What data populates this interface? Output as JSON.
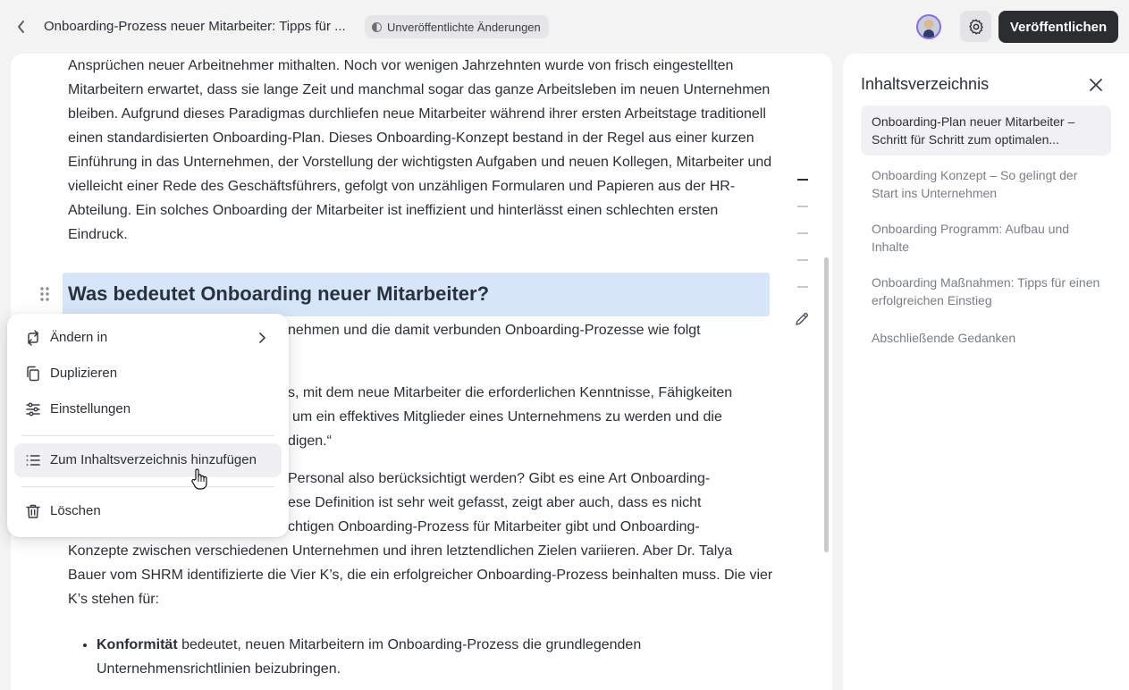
{
  "header": {
    "title": "Onboarding-Prozess neuer Mitarbeiter: Tipps für ...",
    "status": "Unveröffentlichte Änderungen",
    "publish_label": "Veröffentlichen"
  },
  "editor": {
    "paragraph1": "Ansprüchen neuer Arbeitnehmer mithalten. Noch vor wenigen Jahrzehnten wurde von frisch eingestellten Mitarbeitern erwartet, dass sie lange Zeit und manchmal sogar das ganze Arbeitsleben im neuen Unternehmen bleiben. Aufgrund dieses Paradigmas durchliefen neue Mitarbeiter während ihrer ersten Arbeitstage traditionell einen standardisierten Onboarding-Plan. Dieses Onboarding-Konzept bestand in der Regel aus einer kurzen Einführung in das Unternehmen, der Vorstellung der wichtigsten Aufgaben und neuen Kollegen, Mitarbeiter und vielleicht einer Rede des Geschäftsführers, gefolgt von unzähligen Formularen und Papieren aus der HR-Abteilung. Ein solches Onboarding der Mitarbeiter ist ineffizient und hinterlässt einen schlechten ersten Eindruck.",
    "heading": "Was bedeutet Onboarding neuer Mitarbeiter?",
    "paragraph2": "nehmen und die damit verbunden Onboarding-Prozesse wie folgt",
    "paragraph3_line1": "s, mit dem neue Mitarbeiter die erforderlichen Kenntnisse, Fähigkeiten",
    "paragraph3_line2": "um ein effektives Mitglieder eines Unternehmens zu werden und die",
    "paragraph3_line3": "digen.“",
    "paragraph4_line1": "Personal also berücksichtigt werden? Gibt es eine Art Onboarding-",
    "paragraph4_line2": "ese Definition ist sehr weit gefasst, zeigt aber auch, dass es nicht",
    "paragraph4_line3": "chtigen Onboarding-Prozess für Mitarbeiter gibt und Onboarding-",
    "paragraph4_rest": "Konzepte zwischen verschiedenen Unternehmen und ihren letztendlichen Zielen variieren. Aber Dr. Talya Bauer vom SHRM identifizierte die Vier K’s, die ein erfolgreicher Onboarding-Prozess beinhalten muss. Die vier K’s stehen für:",
    "bullet1_bold": "Konformität",
    "bullet1_text": " bedeutet, neuen Mitarbeitern im Onboarding-Prozess die grundlegenden Unternehmensrichtlinien beizubringen."
  },
  "context_menu": {
    "items": [
      {
        "label": "Ändern in",
        "icon": "transform-icon"
      },
      {
        "label": "Duplizieren",
        "icon": "copy-icon"
      },
      {
        "label": "Einstellungen",
        "icon": "sliders-icon"
      },
      {
        "label": "Zum Inhaltsverzeichnis hinzufügen",
        "icon": "list-icon"
      },
      {
        "label": "Löschen",
        "icon": "trash-icon"
      }
    ]
  },
  "toc": {
    "title": "Inhaltsverzeichnis",
    "items": [
      "Onboarding-Plan neuer Mitarbeiter – Schritt für Schritt zum optimalen...",
      "Onboarding Konzept – So gelingt der Start ins Unternehmen",
      "Onboarding Programm: Aufbau und Inhalte",
      "Onboarding Maßnahmen: Tipps für einen erfolgreichen Einstieg",
      "Abschließende Gedanken"
    ]
  }
}
